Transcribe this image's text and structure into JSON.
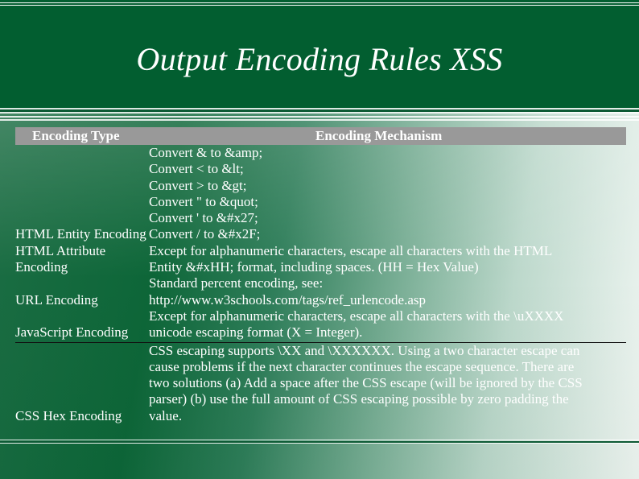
{
  "slide": {
    "title": "Output Encoding Rules XSS",
    "colors": {
      "header_bg": "#025e30",
      "table_header_bg": "#999999",
      "text": "#ffffff"
    }
  },
  "table": {
    "headers": {
      "type": "Encoding Type",
      "mechanism": "Encoding Mechanism"
    },
    "rows": [
      {
        "type": "HTML Entity Encoding",
        "mechanism_lines": [
          "Convert & to &amp;",
          "Convert < to &lt;",
          "Convert > to &gt;",
          "Convert \" to &quot;",
          "Convert ' to &#x27;",
          "Convert / to &#x2F;"
        ]
      },
      {
        "type": "HTML Attribute Encoding",
        "mechanism_lines": [
          "Except for alphanumeric characters, escape all characters with the HTML",
          "Entity &#xHH; format, including spaces. (HH = Hex Value)"
        ]
      },
      {
        "type": "URL Encoding",
        "mechanism_lines": [
          "Standard percent encoding, see:",
          "http://www.w3schools.com/tags/ref_urlencode.asp"
        ]
      },
      {
        "type": "JavaScript Encoding",
        "mechanism_lines": [
          "Except for alphanumeric characters, escape all characters with the \\uXXXX",
          "unicode escaping format (X = Integer)."
        ]
      },
      {
        "type": "CSS Hex Encoding",
        "mechanism_lines": [
          "CSS escaping supports \\XX and \\XXXXXX. Using a two character escape can",
          "cause problems if the next character continues the escape sequence. There are",
          "two solutions (a) Add a space after the CSS escape (will be ignored by the CSS",
          "parser) (b) use the full amount of CSS escaping possible by zero padding the",
          "value."
        ]
      }
    ]
  }
}
